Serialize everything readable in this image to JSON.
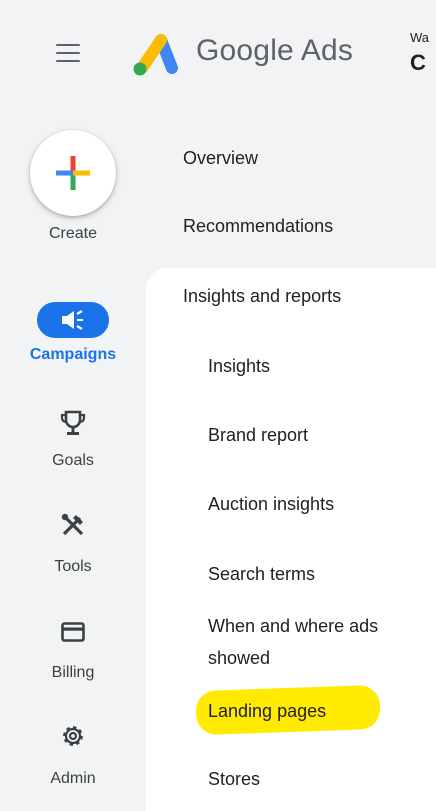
{
  "header": {
    "brand": "Google Ads",
    "account_line1": "Wa",
    "account_line2": "C"
  },
  "rail": {
    "create": "Create",
    "campaigns": "Campaigns",
    "goals": "Goals",
    "tools": "Tools",
    "billing": "Billing",
    "admin": "Admin"
  },
  "nav": {
    "overview": "Overview",
    "recommendations": "Recommendations",
    "insights_and_reports": "Insights and reports",
    "insights": "Insights",
    "brand_report": "Brand report",
    "auction_insights": "Auction insights",
    "search_terms": "Search terms",
    "when_where_line1": "When and where ads",
    "when_where_line2": "showed",
    "landing_pages": "Landing pages",
    "stores": "Stores"
  },
  "colors": {
    "active": "#1a73e8",
    "highlight": "#ffea00",
    "rail_bg": "#f1f3f4"
  }
}
